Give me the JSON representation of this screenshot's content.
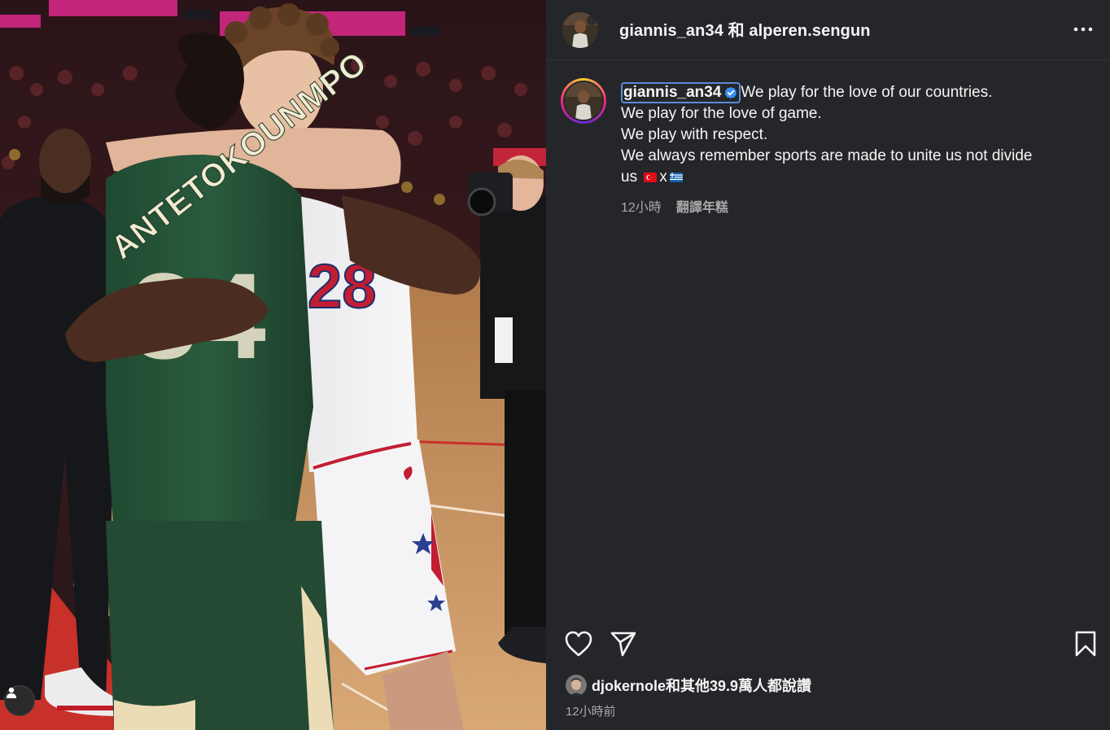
{
  "header": {
    "user1": "giannis_an34",
    "joiner": "和",
    "user2": "alperen.sengun",
    "more_icon": "more-horizontal-icon"
  },
  "caption": {
    "username": "giannis_an34",
    "verified_icon": "verified-badge-icon",
    "lines": [
      "We play for the love of our countries.",
      "We play for the love of game.",
      "We play with respect.",
      "We always remember sports are made to unite us not divide"
    ],
    "last_line_prefix": "us",
    "flag_separator": "x",
    "flags": [
      "turkey-flag-icon",
      "greece-flag-icon"
    ],
    "time": "12小時",
    "translate_label": "翻譯年糕"
  },
  "photo": {
    "jersey_back_name": "ANTETOKOUNMPO",
    "jersey_back_number": "34",
    "jersey_front_number": "28",
    "user_tag_icon": "person-tag-icon"
  },
  "actions": {
    "like_icon": "heart-icon",
    "share_icon": "send-icon",
    "save_icon": "bookmark-icon"
  },
  "likes": {
    "text": "djokernole和其他39.9萬人都說讚"
  },
  "post_time": "12小時前",
  "colors": {
    "panel_bg": "#25262a",
    "focus_outline": "#5b8bd6",
    "verified": "#3b8ff6",
    "muted_text": "#a8a8a8"
  }
}
